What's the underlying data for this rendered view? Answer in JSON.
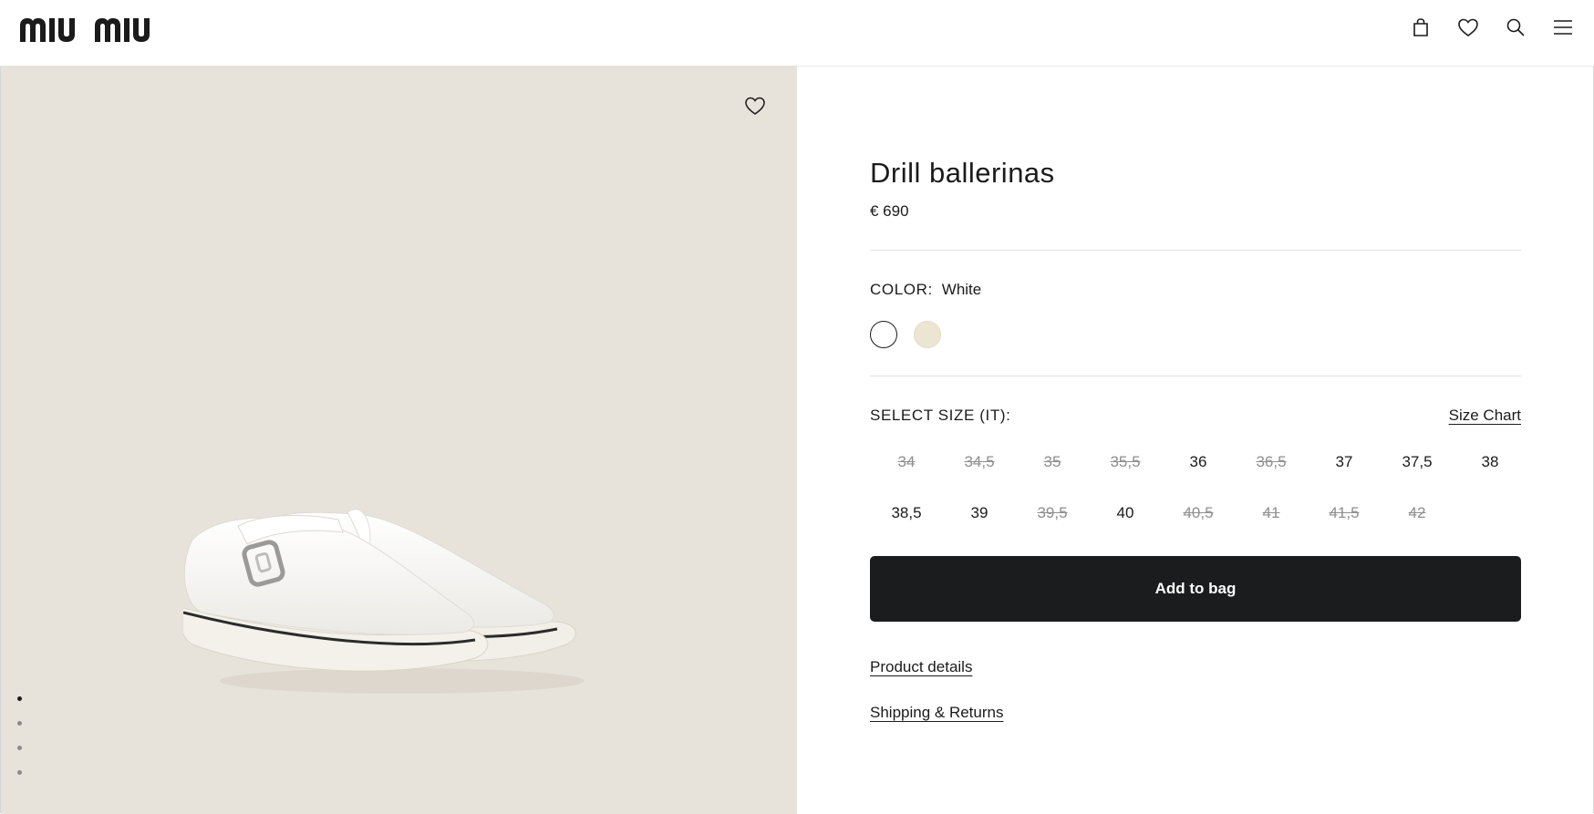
{
  "header": {
    "logo_text": "miu miu",
    "icons": [
      "bag-icon",
      "wishlist-heart-icon",
      "search-icon",
      "menu-icon"
    ]
  },
  "gallery": {
    "image_alt": "White drill Mary Jane ballerinas with buckle strap",
    "active_slide": 1,
    "slide_count": 4,
    "background_color": "#e8e3da"
  },
  "product": {
    "title": "Drill ballerinas",
    "price": "€ 690",
    "color_label": "COLOR:",
    "color_value": "White",
    "swatches": [
      {
        "name": "White",
        "color": "#ffffff",
        "selected": true
      },
      {
        "name": "Cream",
        "color": "#ece5d2",
        "selected": false
      }
    ],
    "size_label": "SELECT SIZE (IT):",
    "size_chart": "Size Chart",
    "sizes": [
      {
        "label": "34",
        "available": false
      },
      {
        "label": "34,5",
        "available": false
      },
      {
        "label": "35",
        "available": false
      },
      {
        "label": "35,5",
        "available": false
      },
      {
        "label": "36",
        "available": true
      },
      {
        "label": "36,5",
        "available": false
      },
      {
        "label": "37",
        "available": true
      },
      {
        "label": "37,5",
        "available": true
      },
      {
        "label": "38",
        "available": true
      },
      {
        "label": "38,5",
        "available": true
      },
      {
        "label": "39",
        "available": true
      },
      {
        "label": "39,5",
        "available": false
      },
      {
        "label": "40",
        "available": true
      },
      {
        "label": "40,5",
        "available": false
      },
      {
        "label": "41",
        "available": false
      },
      {
        "label": "41,5",
        "available": false
      },
      {
        "label": "42",
        "available": false
      }
    ],
    "add_to_bag": "Add to bag",
    "product_details": "Product details",
    "shipping_returns": "Shipping & Returns"
  },
  "colors": {
    "button_bg": "#1b1c1d",
    "text": "#1b1b1b",
    "unavailable_text": "#8f8f8f"
  }
}
